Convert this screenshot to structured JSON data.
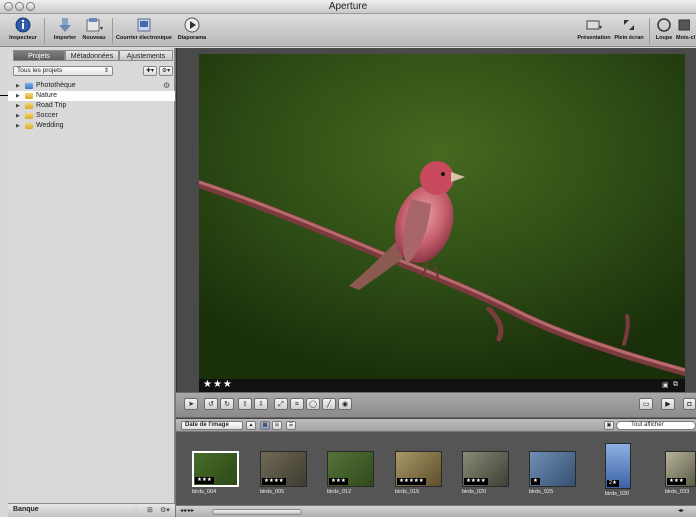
{
  "window": {
    "title": "Aperture"
  },
  "toolbar": {
    "inspector": "Inspecteur",
    "import": "Importer",
    "new": "Nouveau",
    "email": "Courrier électronique",
    "slideshow": "Diaporama",
    "presentation": "Présentation",
    "fullscreen": "Plein écran",
    "loupe": "Loupe",
    "keywords": "Mots-cl"
  },
  "sidebar": {
    "tabs": [
      "Projets",
      "Métadonnées",
      "Ajustements"
    ],
    "active_tab": "Projets",
    "project_filter": "Tous les projets",
    "items": [
      {
        "label": "Photothèque",
        "selected": false
      },
      {
        "label": "Nature",
        "selected": true
      },
      {
        "label": "Road Trip",
        "selected": false
      },
      {
        "label": "Soccer",
        "selected": false
      },
      {
        "label": "Wedding",
        "selected": false
      }
    ],
    "footer_label": "Banque"
  },
  "viewer": {
    "rating": "★★★"
  },
  "browser": {
    "sort_label": "Date de l'image",
    "filter_label": "Tout afficher",
    "thumbnails": [
      {
        "name": "birds_004",
        "rating": "★★★",
        "selected": true
      },
      {
        "name": "birds_005",
        "rating": "★★★★",
        "selected": false
      },
      {
        "name": "birds_012",
        "rating": "★★★",
        "selected": false
      },
      {
        "name": "birds_015",
        "rating": "★★★★★",
        "selected": false
      },
      {
        "name": "birds_020",
        "rating": "★★★★",
        "selected": false
      },
      {
        "name": "birds_025",
        "rating": "★",
        "selected": false
      },
      {
        "name": "birds_030",
        "rating": "2★",
        "selected": false
      },
      {
        "name": "birds_033",
        "rating": "★★★",
        "selected": false
      }
    ]
  },
  "colors": {
    "accent": "#2d5da8",
    "selection_bg": "#ffffff",
    "viewer_bg": "#4a4a4a"
  },
  "icons": [
    "inspector-icon",
    "import-icon",
    "new-icon",
    "email-icon",
    "slideshow-icon",
    "presentation-icon",
    "fullscreen-icon",
    "loupe-icon",
    "keywords-icon",
    "gear-icon"
  ]
}
